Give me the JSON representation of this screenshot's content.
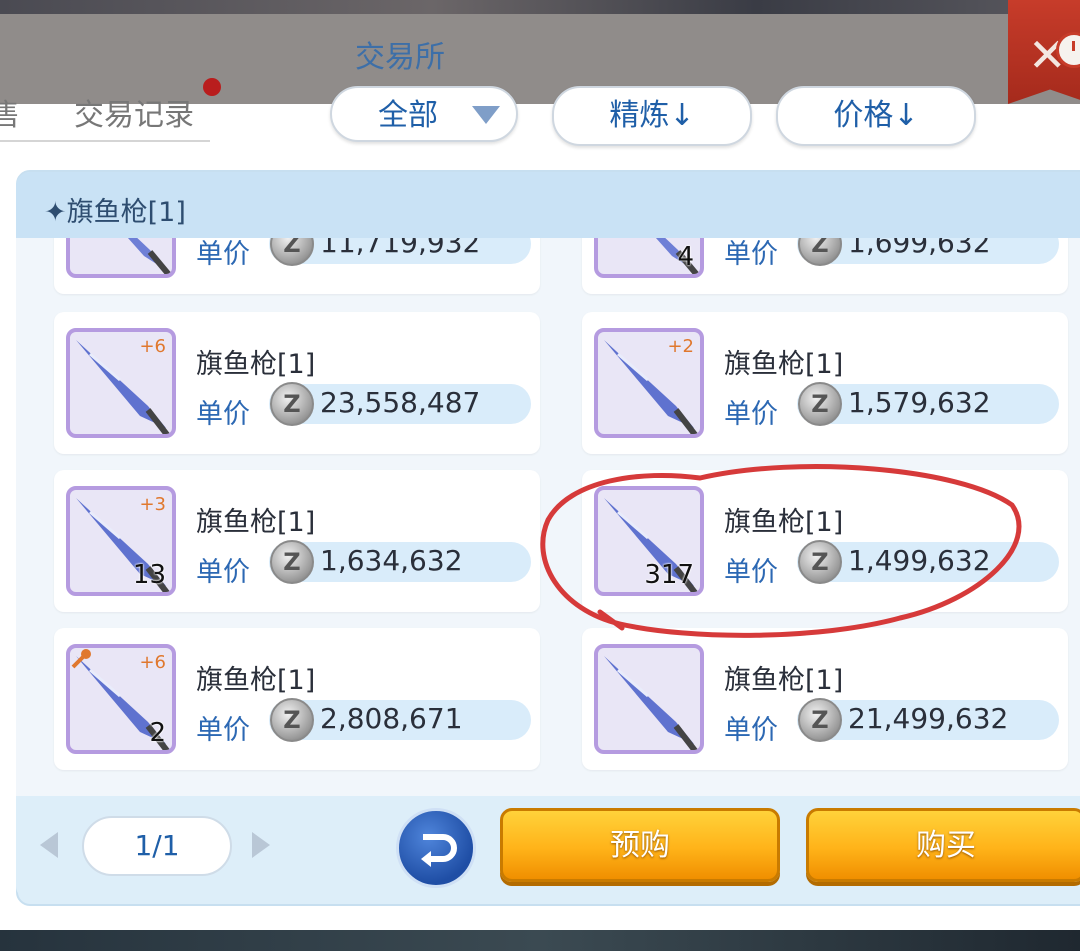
{
  "header": {
    "title": "交易所",
    "tab_partial": "售",
    "tab_record": "交易记录"
  },
  "filters": {
    "category": "全部",
    "refine_sort": "精炼↓",
    "price_sort": "价格↓"
  },
  "list": {
    "header_label": "✦旗鱼枪[1]",
    "price_label": "单价",
    "items": [
      {
        "name": "旗鱼枪[1]",
        "price": "23,558,487",
        "refine": "+6",
        "count": ""
      },
      {
        "name": "旗鱼枪[1]",
        "price": "1,579,632",
        "refine": "+2",
        "count": ""
      },
      {
        "name": "旗鱼枪[1]",
        "price": "1,634,632",
        "refine": "+3",
        "count": "13"
      },
      {
        "name": "旗鱼枪[1]",
        "price": "1,499,632",
        "refine": "",
        "count": "317"
      },
      {
        "name": "旗鱼枪[1]",
        "price": "2,808,671",
        "refine": "+6",
        "count": "2"
      },
      {
        "name": "旗鱼枪[1]",
        "price": "21,499,632",
        "refine": "",
        "count": ""
      }
    ],
    "partial_top": {
      "left_price": "11,719,932",
      "right_price": "1,699,632",
      "right_count": "4"
    }
  },
  "footer": {
    "page": "1/1",
    "preorder_label": "预购",
    "buy_label": "购买"
  },
  "colors": {
    "accent_blue": "#2c68b3",
    "button_orange": "#ffb319",
    "close_red": "#c73c2a",
    "annotation_red": "#d63a3a"
  },
  "icons": {
    "coin": "zeny-coin-icon",
    "close": "close-icon",
    "dropdown": "triangle-down-icon",
    "back": "return-arrow-icon"
  }
}
